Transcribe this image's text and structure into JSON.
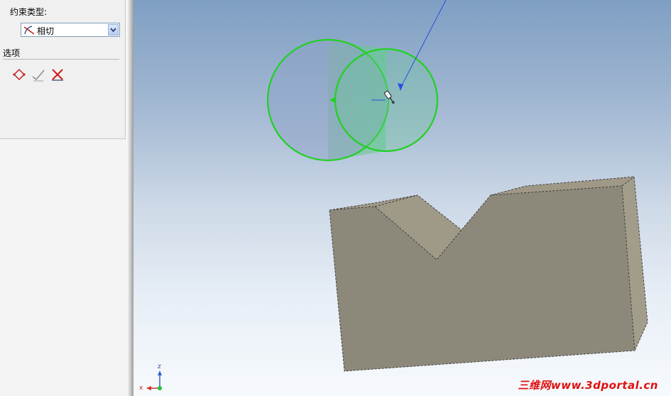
{
  "panel": {
    "constraint_type_label": "约束类型:",
    "constraint_type_value": "相切",
    "options_label": "选项",
    "option_icons": [
      "flip-direction-icon",
      "toggle-constraint-icon",
      "delete-constraint-icon"
    ]
  },
  "viewport": {
    "triad": {
      "x_label": "x",
      "z_label": "z"
    },
    "watermark": "三维网www.3dportal.cn",
    "colors": {
      "selection_green": "#22d022",
      "part_face": "#8c897a",
      "part_face_light": "#a09886",
      "part_face_side": "#9f9a88",
      "leader_blue": "#2a4fe0"
    }
  }
}
